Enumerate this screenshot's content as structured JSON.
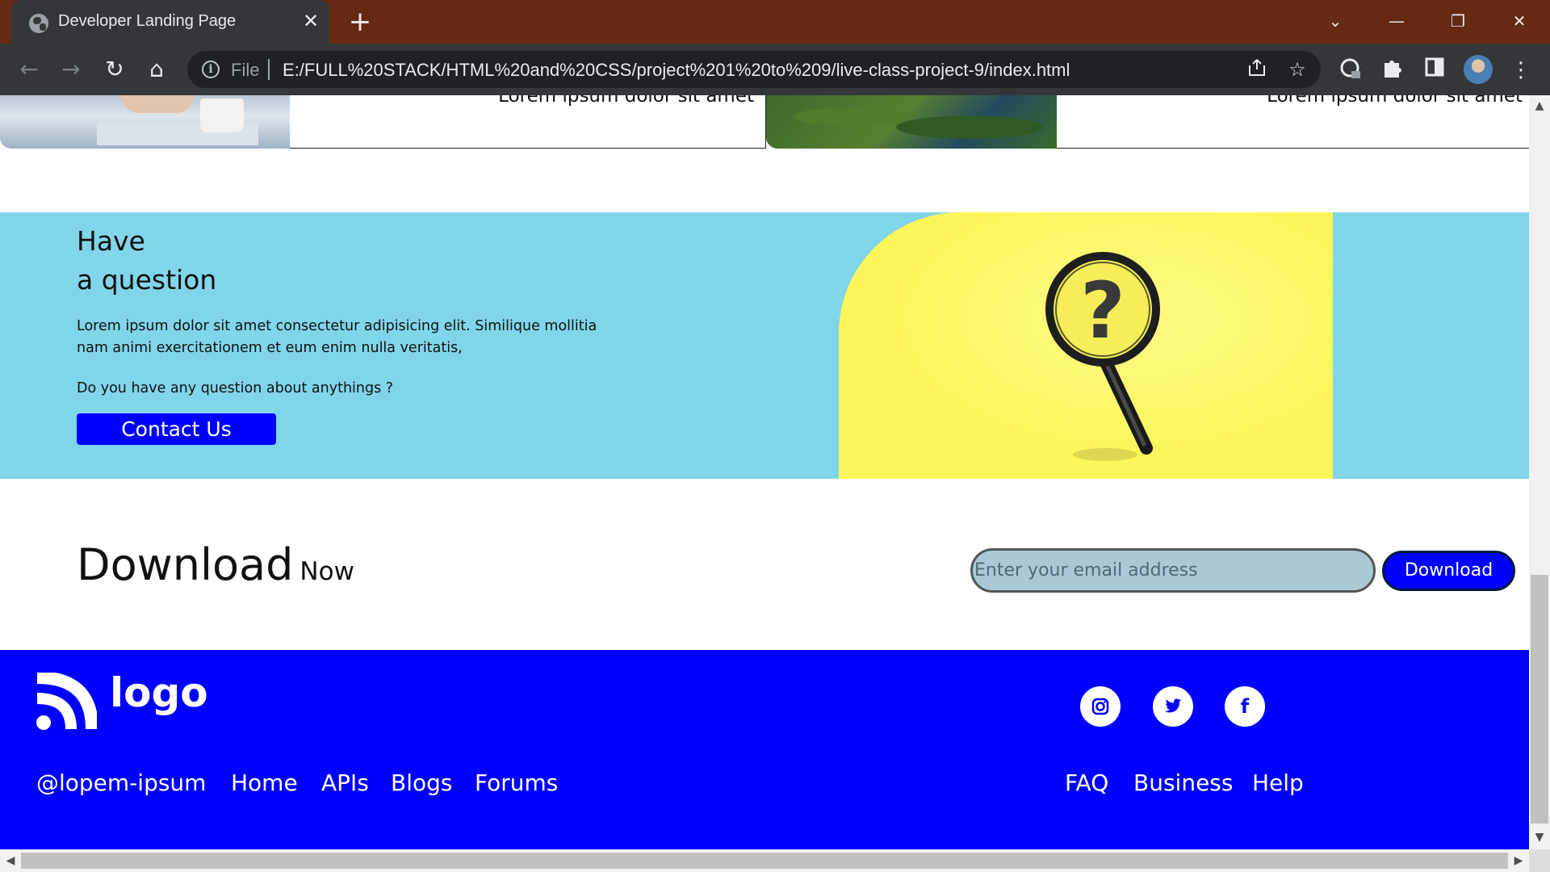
{
  "browser": {
    "tab_title": "Developer Landing Page",
    "tab_close": "✕",
    "new_tab": "+",
    "window_controls": {
      "minimize": "—",
      "restore": "❐",
      "close": "✕",
      "tab_search": "⌄"
    },
    "scheme": "File",
    "url": "E:/FULL%20STACK/HTML%20and%20CSS/project%201%20to%209/live-class-project-9/index.html",
    "nav": {
      "back": "←",
      "forward": "→",
      "reload": "↻",
      "home": "⌂"
    },
    "icons": [
      "info-icon",
      "share-icon",
      "bookmark-star-icon",
      "extension-icon",
      "puzzle-icon",
      "sidepanel-icon",
      "profile-avatar",
      "menu-icon"
    ]
  },
  "cards": {
    "caption_1": "Lorem ipsum dolor sit amet",
    "caption_2": "Lorem ipsum dolor sit amet"
  },
  "question": {
    "heading_line1": "Have",
    "heading_line2": "a question",
    "text": "Lorem ipsum dolor sit amet consectetur adipisicing elit. Similique mollitia nam animi exercitationem et eum enim nulla veritatis,",
    "ask": "Do you have any question about anythings ?",
    "contact_label": "Contact Us",
    "image_glyph": "?"
  },
  "download": {
    "title_big": "Download",
    "title_small": "Now",
    "email_placeholder": "Enter your email address",
    "button_label": "Download"
  },
  "footer": {
    "logo_text": "logo",
    "social": [
      "instagram-icon",
      "twitter-icon",
      "facebook-icon"
    ],
    "facebook_glyph": "f",
    "left_links": [
      "@lopem-ipsum",
      "Home",
      "APIs",
      "Blogs",
      "Forums"
    ],
    "right_links": [
      "FAQ",
      "Business",
      "Help"
    ]
  },
  "colors": {
    "tab_strip": "#662a12",
    "question_bg": "#80d5e9",
    "question_image_bg": "#fcf65a",
    "accent_blue": "#0000ff",
    "email_input_bg": "#a9cad5"
  }
}
